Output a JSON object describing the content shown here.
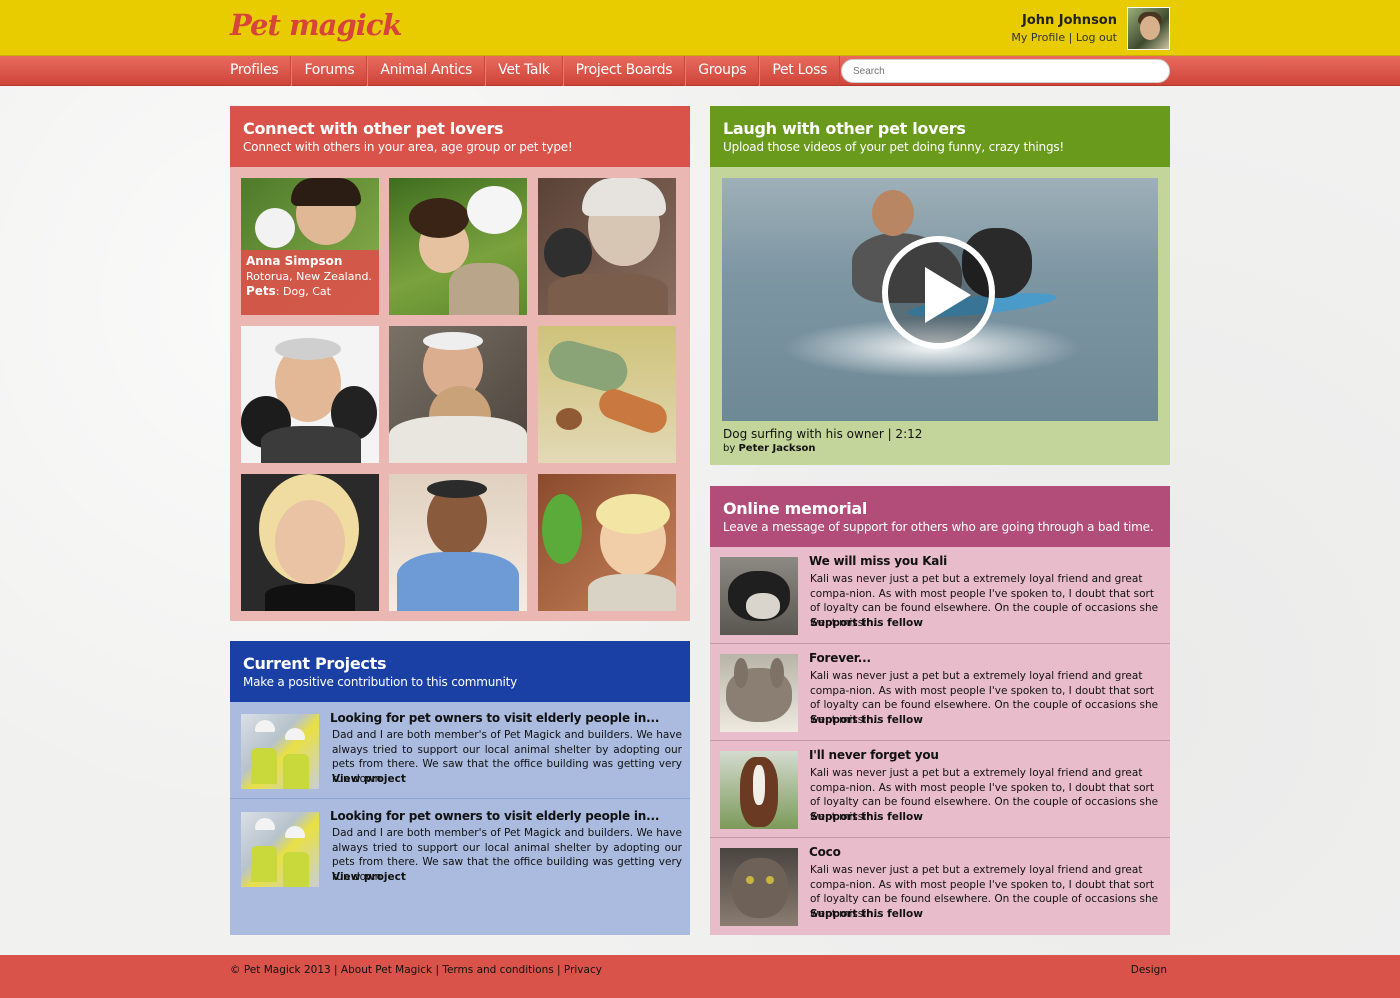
{
  "header": {
    "logo": "Pet magick",
    "user_name": "John Johnson",
    "my_profile": "My Profile",
    "separator": "|",
    "log_out": "Log out"
  },
  "nav": {
    "items": [
      "Profiles",
      "Forums",
      "Animal Antics",
      "Vet Talk",
      "Project Boards",
      "Groups",
      "Pet Loss"
    ],
    "search_placeholder": "Search"
  },
  "connect": {
    "title": "Connect with other pet lovers",
    "subtitle": "Connect with others in your area, age group or pet type!",
    "featured": {
      "name": "Anna Simpson",
      "location": "Rotorua, New Zealand.",
      "pets_label": "Pets",
      "pets_value": ": Dog, Cat"
    }
  },
  "laugh": {
    "title": "Laugh with other pet lovers",
    "subtitle": "Upload those videos of your pet doing funny, crazy things!",
    "video_caption": "Dog surfing with his owner | 2:12",
    "by_label": "by ",
    "by_author": "Peter Jackson"
  },
  "projects": {
    "title": "Current Projects",
    "subtitle": "Make a positive contribution to this community",
    "items": [
      {
        "title": "Looking for pet owners to visit elderly people in...",
        "text": "Dad and I are both member's of Pet Magick and builders. We have always tried to support our local animal shelter by adopting our pets from there. We saw that the office building was getting very run down",
        "link": "View project"
      },
      {
        "title": "Looking for pet owners to visit elderly people in...",
        "text": "Dad and I are both member's of Pet Magick and builders. We have always tried to support our local animal shelter by adopting our pets from there. We saw that the office building was getting very run down",
        "link": "View project"
      }
    ]
  },
  "memorial": {
    "title": "Online memorial",
    "subtitle": "Leave a message of support for others who are going through a bad time.",
    "items": [
      {
        "title": "We will miss you Kali",
        "text": "Kali was never just a pet but a extremely loyal friend and great compa-nion. As with most people I've spoken to, I doubt that sort of loyalty can be found elsewhere. On the couple of occasions she went missin...",
        "link": "Support this fellow"
      },
      {
        "title": "Forever...",
        "text": "Kali was never just a pet but a extremely loyal friend and great compa-nion. As with most people I've spoken to, I doubt that sort of loyalty can be found elsewhere. On the couple of occasions she went missin...",
        "link": "Support this fellow"
      },
      {
        "title": "I'll never forget you",
        "text": "Kali was never just a pet but a extremely loyal friend and great compa-nion. As with most people I've spoken to, I doubt that sort of loyalty can be found elsewhere. On the couple of occasions she went missin...",
        "link": "Support this fellow"
      },
      {
        "title": "Coco",
        "text": "Kali was never just a pet but a extremely loyal friend and great compa-nion. As with most people I've spoken to, I doubt that sort of loyalty can be found elsewhere. On the couple of occasions she went missin...",
        "link": "Support this fellow"
      }
    ]
  },
  "footer": {
    "copyright": "© Pet Magick 2013",
    "separator": " | ",
    "about": "About Pet Magick",
    "terms": "Terms and conditions",
    "privacy": "Privacy",
    "design": "Design"
  },
  "colors": {
    "header_yellow": "#e8cc00",
    "brand_red": "#d9534a",
    "connect_bg": "#ebb7b2",
    "laugh_green": "#6a9a1c",
    "laugh_bg": "#c3d59a",
    "projects_blue": "#1a40a6",
    "projects_bg": "#aabbdf",
    "memorial_plum": "#b14d78",
    "memorial_bg": "#e8bcca"
  }
}
